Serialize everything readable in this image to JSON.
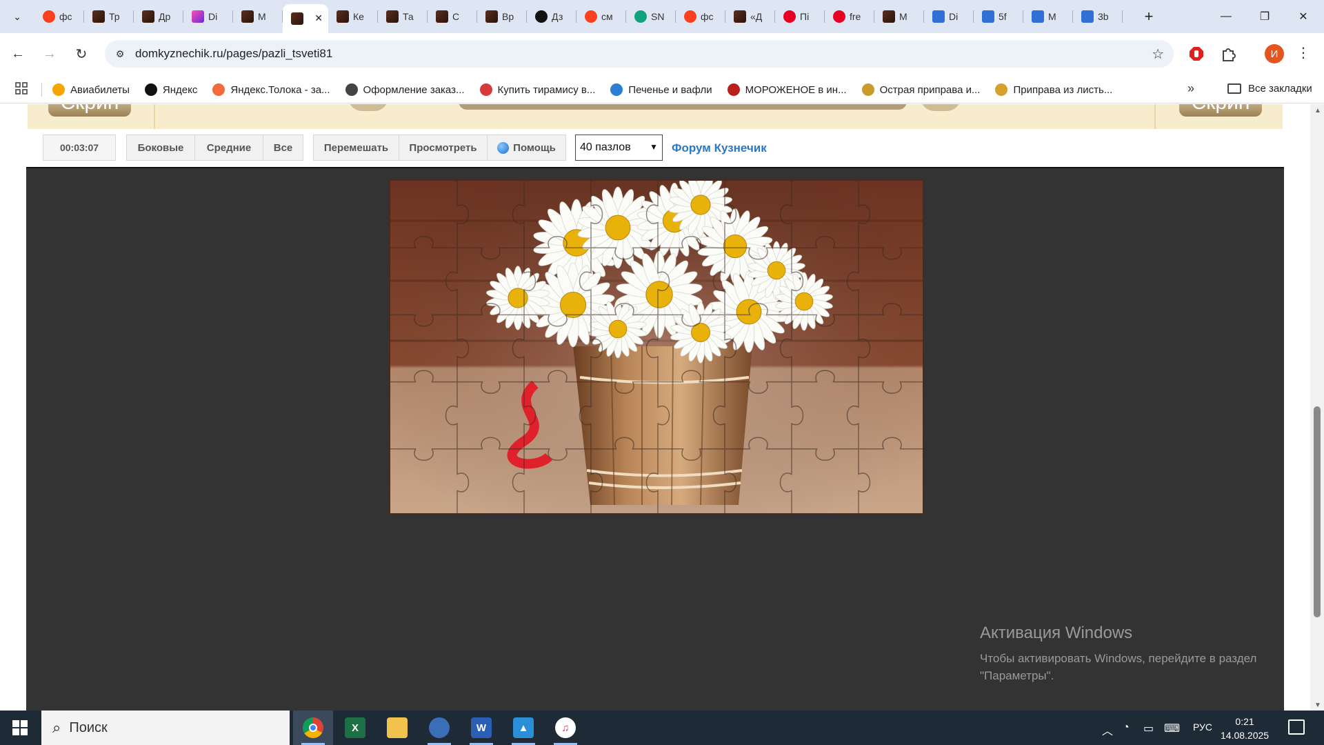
{
  "browser": {
    "tabs": [
      {
        "label": "фс",
        "icon": "yandex-icon"
      },
      {
        "label": "Тр",
        "icon": "site-favicon"
      },
      {
        "label": "Др",
        "icon": "site-favicon"
      },
      {
        "label": "Di",
        "icon": "app-icon"
      },
      {
        "label": "М",
        "icon": "site-favicon"
      },
      {
        "label": "",
        "icon": "site-favicon",
        "active": true
      },
      {
        "label": "Ке",
        "icon": "site-favicon"
      },
      {
        "label": "Та",
        "icon": "site-favicon"
      },
      {
        "label": "С",
        "icon": "site-favicon"
      },
      {
        "label": "Вр",
        "icon": "site-favicon"
      },
      {
        "label": "Дз",
        "icon": "sparkle-icon"
      },
      {
        "label": "см",
        "icon": "yandex-icon"
      },
      {
        "label": "SN",
        "icon": "chatgpt-icon"
      },
      {
        "label": "фс",
        "icon": "yandex-icon"
      },
      {
        "label": "«Д",
        "icon": "site-favicon"
      },
      {
        "label": "Пі",
        "icon": "pinterest-icon"
      },
      {
        "label": "fre",
        "icon": "pinterest-icon"
      },
      {
        "label": "М",
        "icon": "site-favicon"
      },
      {
        "label": "Di",
        "icon": "doc-icon"
      },
      {
        "label": "5f",
        "icon": "doc-icon"
      },
      {
        "label": "М",
        "icon": "doc-icon"
      },
      {
        "label": "3b",
        "icon": "doc-icon"
      }
    ],
    "url": "domkyznechik.ru/pages/pazli_tsveti81",
    "avatar_letter": "И",
    "bookmarks": [
      {
        "label": "Авиабилеты",
        "color": "#f7a600"
      },
      {
        "label": "Яндекс",
        "color": "#111111"
      },
      {
        "label": "Яндекс.Толока - за...",
        "color": "#f26b3a"
      },
      {
        "label": "Оформление заказ...",
        "color": "#444444"
      },
      {
        "label": "Купить тирамису в...",
        "color": "#d83a3a"
      },
      {
        "label": "Печенье и вафли",
        "color": "#2a7fd0"
      },
      {
        "label": "МОРОЖЕНОЕ в ин...",
        "color": "#b8201e"
      },
      {
        "label": "Острая приправа и...",
        "color": "#c89b2a"
      },
      {
        "label": "Приправа из листь...",
        "color": "#d4a12b"
      }
    ],
    "all_bookmarks": "Все закладки"
  },
  "page": {
    "timer": "00:03:07",
    "buttons": {
      "side": "Боковые",
      "middle": "Средние",
      "all": "Все",
      "shuffle": "Перемешать",
      "preview": "Просмотреть",
      "help": "Помощь"
    },
    "pieces_select": "40 пазлов",
    "forum_link": "Форум Кузнечик",
    "banner_button": "Скрин",
    "puzzle": {
      "cols": 8,
      "rows": 5
    }
  },
  "watermark": {
    "title": "Активация Windows",
    "text": "Чтобы активировать Windows, перейдите в раздел \"Параметры\"."
  },
  "taskbar": {
    "search_placeholder": "Поиск",
    "lang": "РУС",
    "time": "0:21",
    "date": "14.08.2025"
  }
}
